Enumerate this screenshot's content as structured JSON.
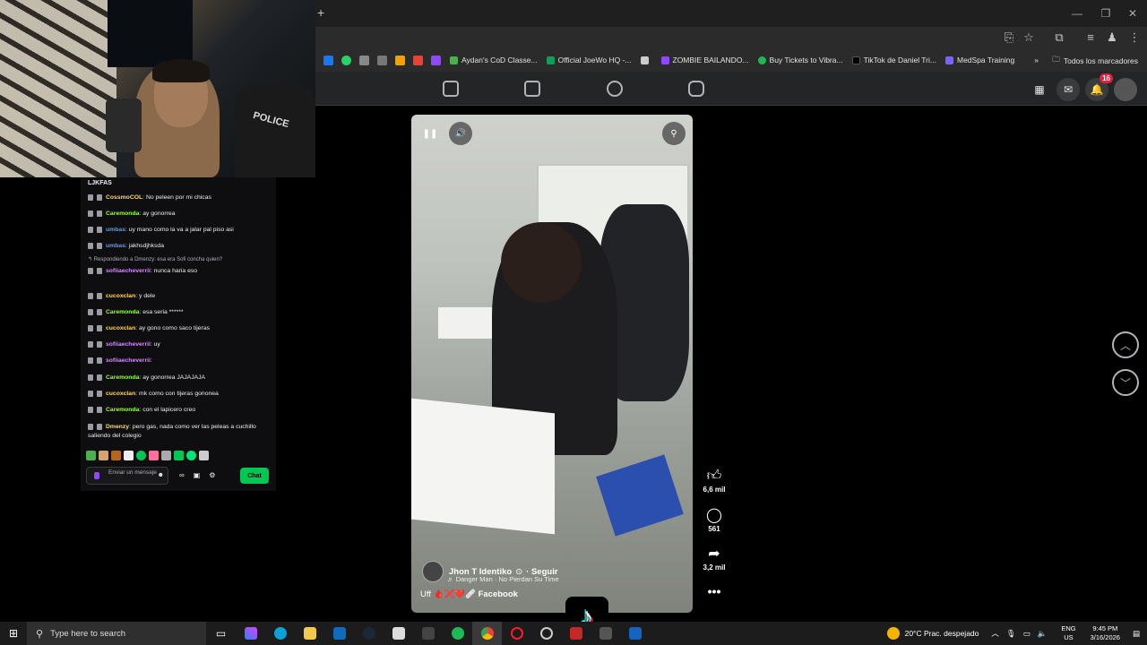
{
  "window": {
    "new_tab_symbol": "+"
  },
  "bookmarks": [
    "Aydan's CoD Classe...",
    "Official JoeWo HQ -...",
    "ZOMBIE BAILANDO...",
    "Buy Tickets to Vibra...",
    "TikTok de Daniel Tri...",
    "MedSpa Training"
  ],
  "bookmarks_overflow": "»",
  "bookmarks_folder": "Todos los marcadores",
  "fb": {
    "notifications": "16"
  },
  "chat": {
    "header": "LJKFAS",
    "reply_note": "↰ Respondiendo a Dmenzy: esa era Sofi concha quien?",
    "messages": [
      {
        "user": "CossmoCOL",
        "color": "#ffd86b",
        "text": "No peleen por mi chicas"
      },
      {
        "user": "Caremonda",
        "color": "#9efb3f",
        "text": "ay gonorrea"
      },
      {
        "user": "umbas",
        "color": "#5b9bff",
        "text": "uy mano como la va a jalar pal piso asi"
      },
      {
        "user": "umbas",
        "color": "#5b9bff",
        "text": "jakhsdjhksda"
      },
      {
        "user": "sofiiaecheverrii",
        "color": "#d58bff",
        "text": "nunca haria eso"
      },
      {
        "user": "cucoxclan",
        "color": "#ffd86b",
        "text": "y dele"
      },
      {
        "user": "Caremonda",
        "color": "#9efb3f",
        "text": "esa seria ******"
      },
      {
        "user": "cucoxclan",
        "color": "#ffd86b",
        "text": "ay gono como saco tijeras"
      },
      {
        "user": "sofiiaecheverrii",
        "color": "#d58bff",
        "text": "uy"
      },
      {
        "user": "sofiiaecheverrii",
        "color": "#d58bff",
        "text": ""
      },
      {
        "user": "Caremonda",
        "color": "#9efb3f",
        "text": "ay gonorrea JAJAJAJA"
      },
      {
        "user": "cucoxclan",
        "color": "#ffd86b",
        "text": "mk como con tijeras gononea"
      },
      {
        "user": "Caremonda",
        "color": "#9efb3f",
        "text": "con el lapicero creo"
      },
      {
        "user": "Dmenzy",
        "color": "#ffd86b",
        "text": "pero gas, nada como ver las peleas a cuchillo saliendo del colegio"
      }
    ],
    "input_placeholder": "Enviar un mensaje",
    "chat_button": "Chat"
  },
  "reel": {
    "author": "Jhon T Identiko",
    "follow": "· Seguir",
    "music": "♬ Danger Man · No Pierdan Su Time",
    "caption_prefix": "Uff",
    "caption_emojis": "🩸❌❤️🩹",
    "caption_source": "Facebook",
    "likes": "6,6 mil",
    "comments": "561",
    "shares": "3,2 mil"
  },
  "webcam": {
    "chair_text": "POLICE"
  },
  "taskbar": {
    "search_placeholder": "Type here to search",
    "weather": "20°C  Prac. despejado",
    "lang_top": "ENG",
    "lang_bottom": "US",
    "time": "9:45 PM",
    "date": "3/16/2026"
  }
}
